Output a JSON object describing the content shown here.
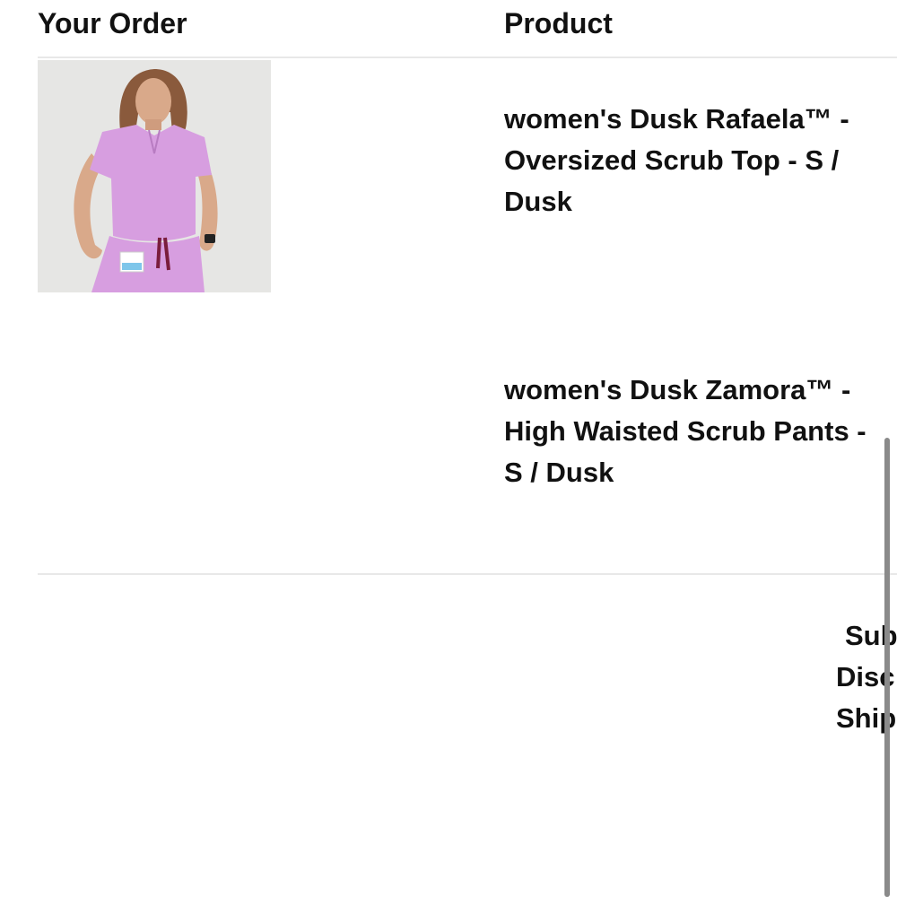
{
  "header": {
    "order_label": "Your Order",
    "product_label": "Product"
  },
  "order": {
    "items": [
      {
        "name": "women's Dusk Rafaela™ - Oversized Scrub Top - S / Dusk",
        "image": "model-in-lavender-scrub-top-photo"
      },
      {
        "name": "women's Dusk Zamora™ - High Waisted Scrub Pants - S / Dusk"
      }
    ]
  },
  "totals": {
    "subtotal_label": "Sub",
    "discount_label": "Disc",
    "shipping_label": "Ship"
  },
  "colors": {
    "text": "#111111",
    "divider": "#e8e8e8",
    "scrub_color": "#d79ee0",
    "scrollbar": "#8a8a8a"
  }
}
